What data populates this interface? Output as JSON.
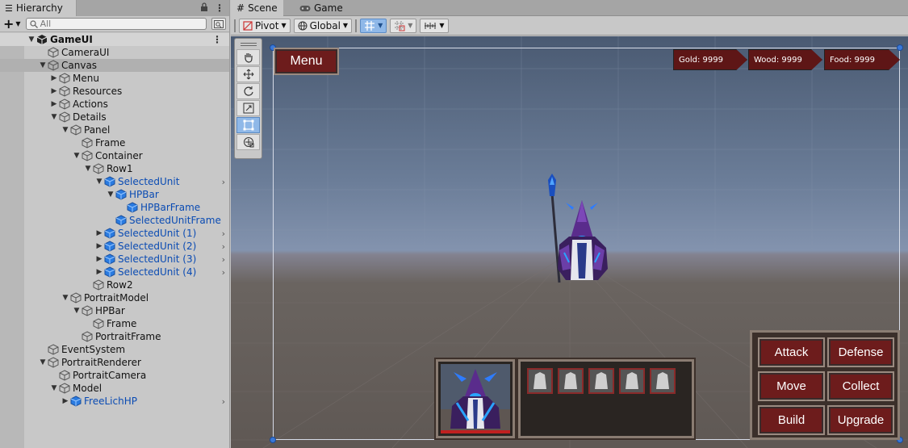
{
  "hierarchy": {
    "tab_label": "Hierarchy",
    "search_placeholder": "All",
    "rows": [
      {
        "label": "GameUI",
        "depth": 0,
        "expanded": true,
        "scene": true
      },
      {
        "label": "CameraUI",
        "depth": 1
      },
      {
        "label": "Canvas",
        "depth": 1,
        "expanded": true,
        "highlight": true
      },
      {
        "label": "Menu",
        "depth": 2,
        "collapsed": true
      },
      {
        "label": "Resources",
        "depth": 2,
        "collapsed": true
      },
      {
        "label": "Actions",
        "depth": 2,
        "collapsed": true
      },
      {
        "label": "Details",
        "depth": 2,
        "expanded": true
      },
      {
        "label": "Panel",
        "depth": 3,
        "expanded": true
      },
      {
        "label": "Frame",
        "depth": 4
      },
      {
        "label": "Container",
        "depth": 4,
        "expanded": true
      },
      {
        "label": "Row1",
        "depth": 5,
        "expanded": true
      },
      {
        "label": "SelectedUnit",
        "depth": 6,
        "expanded": true,
        "prefab": true,
        "chevron": true
      },
      {
        "label": "HPBar",
        "depth": 7,
        "expanded": true,
        "prefab": true
      },
      {
        "label": "HPBarFrame",
        "depth": 8,
        "prefab": true
      },
      {
        "label": "SelectedUnitFrame",
        "depth": 7,
        "prefab": true
      },
      {
        "label": "SelectedUnit (1)",
        "depth": 6,
        "collapsed": true,
        "prefab": true,
        "chevron": true
      },
      {
        "label": "SelectedUnit (2)",
        "depth": 6,
        "collapsed": true,
        "prefab": true,
        "chevron": true
      },
      {
        "label": "SelectedUnit (3)",
        "depth": 6,
        "collapsed": true,
        "prefab": true,
        "chevron": true
      },
      {
        "label": "SelectedUnit (4)",
        "depth": 6,
        "collapsed": true,
        "prefab": true,
        "chevron": true
      },
      {
        "label": "Row2",
        "depth": 5
      },
      {
        "label": "PortraitModel",
        "depth": 3,
        "expanded": true
      },
      {
        "label": "HPBar",
        "depth": 4,
        "expanded": true
      },
      {
        "label": "Frame",
        "depth": 5
      },
      {
        "label": "PortraitFrame",
        "depth": 4
      },
      {
        "label": "EventSystem",
        "depth": 1
      },
      {
        "label": "PortraitRenderer",
        "depth": 1,
        "expanded": true
      },
      {
        "label": "PortraitCamera",
        "depth": 2
      },
      {
        "label": "Model",
        "depth": 2,
        "expanded": true
      },
      {
        "label": "FreeLichHP",
        "depth": 3,
        "collapsed": true,
        "prefab": true,
        "chevron": true
      }
    ]
  },
  "scene": {
    "tabs": [
      {
        "label": "Scene",
        "active": true
      },
      {
        "label": "Game",
        "active": false
      }
    ],
    "pivot_label": "Pivot",
    "global_label": "Global",
    "menu_label": "Menu",
    "resources": [
      "Gold: 9999",
      "Wood: 9999",
      "Food: 9999"
    ],
    "actions": [
      "Attack",
      "Defense",
      "Move",
      "Collect",
      "Build",
      "Upgrade"
    ]
  },
  "colors": {
    "prefab_text": "#0a4bb3",
    "button_red": "#6d1c1c",
    "selection_blue": "#8fb8e8"
  }
}
